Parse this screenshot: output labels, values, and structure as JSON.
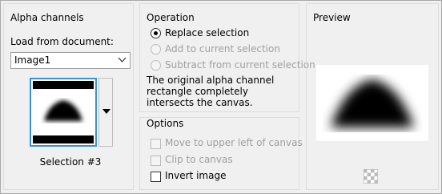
{
  "alpha": {
    "title": "Alpha channels",
    "load_label": "Load from document:",
    "document_value": "Image1",
    "selection_label": "Selection #3"
  },
  "operation": {
    "title": "Operation",
    "replace": "Replace selection",
    "add": "Add to current selection",
    "subtract": "Subtract from current selection",
    "description": "The original alpha channel rectangle completely intersects the canvas.",
    "selected": "Replace selection"
  },
  "options": {
    "title": "Options",
    "move": "Move to upper left of canvas",
    "clip": "Clip to canvas",
    "invert": "Invert image",
    "invert_checked": false
  },
  "preview": {
    "title": "Preview"
  },
  "icons": {
    "dropdown": "chevron-down-icon",
    "transparency": "checkerboard-icon"
  }
}
